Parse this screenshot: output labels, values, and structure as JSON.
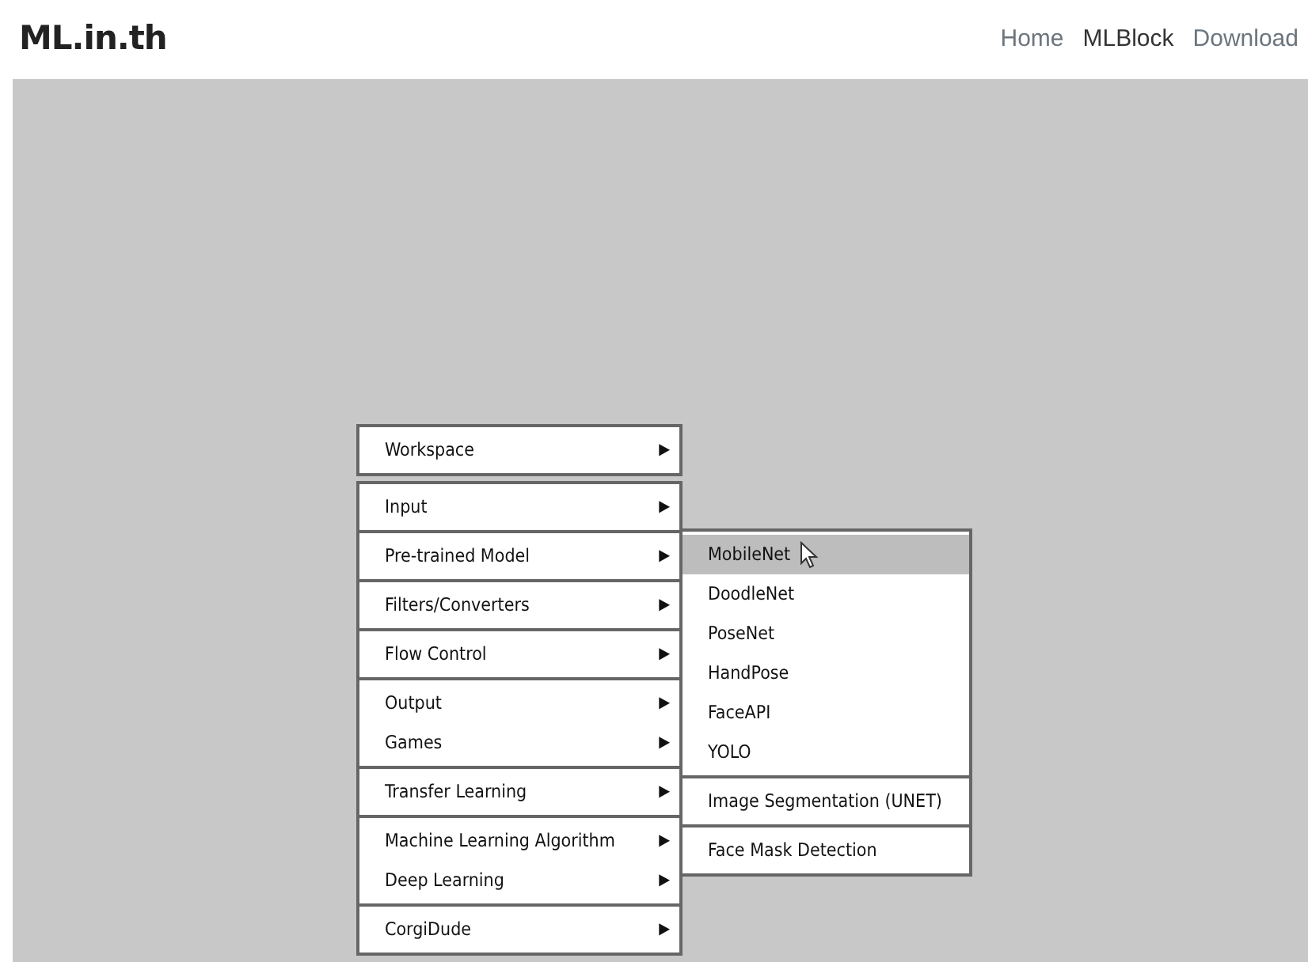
{
  "brand": "ML.in.th",
  "nav": [
    {
      "label": "Home",
      "selected": false
    },
    {
      "label": "MLBlock",
      "selected": true
    },
    {
      "label": "Download",
      "selected": false
    }
  ],
  "menu": {
    "groups": [
      {
        "items": [
          {
            "label": "Workspace",
            "arrow": "▶"
          }
        ]
      },
      {
        "items": [
          {
            "label": "Input",
            "arrow": "▶"
          }
        ]
      },
      {
        "items": [
          {
            "label": "Pre-trained Model",
            "arrow": "▶"
          }
        ]
      },
      {
        "items": [
          {
            "label": "Filters/Converters",
            "arrow": "▶"
          }
        ]
      },
      {
        "items": [
          {
            "label": "Flow Control",
            "arrow": "▶"
          }
        ]
      },
      {
        "items": [
          {
            "label": "Output",
            "arrow": "▶"
          },
          {
            "label": "Games",
            "arrow": "▶"
          }
        ]
      },
      {
        "items": [
          {
            "label": "Transfer Learning",
            "arrow": "▶"
          }
        ]
      },
      {
        "items": [
          {
            "label": "Machine Learning Algorithm",
            "arrow": "▶"
          },
          {
            "label": "Deep Learning",
            "arrow": "▶"
          }
        ]
      },
      {
        "items": [
          {
            "label": "CorgiDude",
            "arrow": "▶"
          }
        ]
      }
    ]
  },
  "submenu": {
    "groups": [
      {
        "items": [
          {
            "label": "MobileNet",
            "selected": true
          },
          {
            "label": "DoodleNet",
            "selected": false
          },
          {
            "label": "PoseNet",
            "selected": false
          },
          {
            "label": "HandPose",
            "selected": false
          },
          {
            "label": "FaceAPI",
            "selected": false
          },
          {
            "label": "YOLO",
            "selected": false
          }
        ]
      },
      {
        "items": [
          {
            "label": "Image Segmentation (UNET)",
            "selected": false
          }
        ]
      },
      {
        "items": [
          {
            "label": "Face Mask Detection",
            "selected": false
          }
        ]
      }
    ]
  }
}
